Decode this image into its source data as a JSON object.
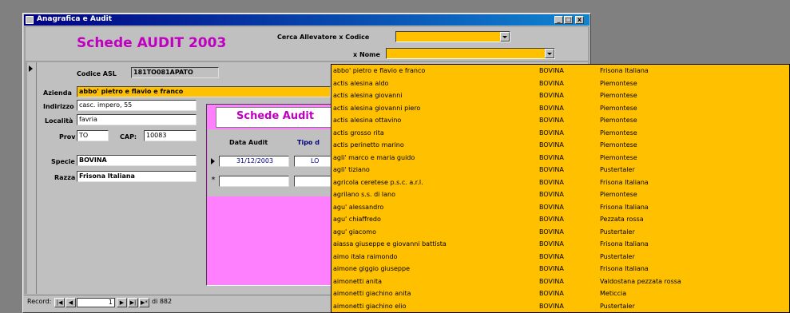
{
  "window": {
    "title": "Anagrafica e Audit",
    "controls": [
      "_",
      "□",
      "x"
    ]
  },
  "header": {
    "title": "Schede AUDIT 2003",
    "search_code_label": "Cerca Allevatore x Codice",
    "search_name_label": "x Nome"
  },
  "form": {
    "codice_asl_label": "Codice ASL",
    "codice_asl_value": "181TO081APATO",
    "azienda_label": "Azienda",
    "azienda_value": "abbo' pietro e flavio e franco",
    "indirizzo_label": "Indirizzo",
    "indirizzo_value": "casc. impero, 55",
    "localita_label": "Località",
    "localita_value": "favria",
    "prov_label": "Prov",
    "prov_value": "TO",
    "cap_label": "CAP:",
    "cap_value": "10083",
    "specie_label": "Specie",
    "specie_value": "BOVINA",
    "razza_label": "Razza",
    "razza_value": "Frisona Italiana"
  },
  "subform": {
    "title": "Schede Audit",
    "col_date": "Data Audit",
    "col_tipo": "Tipo d",
    "row1_date": "31/12/2003",
    "row1_tipo": "LO"
  },
  "recnav": {
    "label": "Record:",
    "current": "1",
    "total": "di 882"
  },
  "dropdown": {
    "rows": [
      [
        "abbo' pietro e flavio e franco",
        "BOVINA",
        "Frisona Italiana"
      ],
      [
        "actis alesina aldo",
        "BOVINA",
        "Piemontese"
      ],
      [
        "actis alesina giovanni",
        "BOVINA",
        "Piemontese"
      ],
      [
        "actis alesina giovanni piero",
        "BOVINA",
        "Piemontese"
      ],
      [
        "actis alesina ottavino",
        "BOVINA",
        "Piemontese"
      ],
      [
        "actis grosso rita",
        "BOVINA",
        "Piemontese"
      ],
      [
        "actis perinetto marino",
        "BOVINA",
        "Piemontese"
      ],
      [
        "agli' marco e maria guido",
        "BOVINA",
        "Piemontese"
      ],
      [
        "agli' tiziano",
        "BOVINA",
        "Pustertaler"
      ],
      [
        "agricola ceretese p.s.c. a.r.l.",
        "BOVINA",
        "Frisona Italiana"
      ],
      [
        "agrilano s.s. di lano",
        "BOVINA",
        "Piemontese"
      ],
      [
        "agu' alessandro",
        "BOVINA",
        "Frisona Italiana"
      ],
      [
        "agu' chiaffredo",
        "BOVINA",
        "Pezzata rossa"
      ],
      [
        "agu' giacomo",
        "BOVINA",
        "Pustertaler"
      ],
      [
        "aiassa giuseppe e giovanni battista",
        "BOVINA",
        "Frisona Italiana"
      ],
      [
        "aimo itala raimondo",
        "BOVINA",
        "Pustertaler"
      ],
      [
        "aimone giggio giuseppe",
        "BOVINA",
        "Frisona Italiana"
      ],
      [
        "aimonetti anita",
        "BOVINA",
        "Valdostana pezzata rossa"
      ],
      [
        "aimonetti giachino anita",
        "BOVINA",
        "Meticcia"
      ],
      [
        "aimonetti giachino elio",
        "BOVINA",
        "Pustertaler"
      ]
    ]
  }
}
